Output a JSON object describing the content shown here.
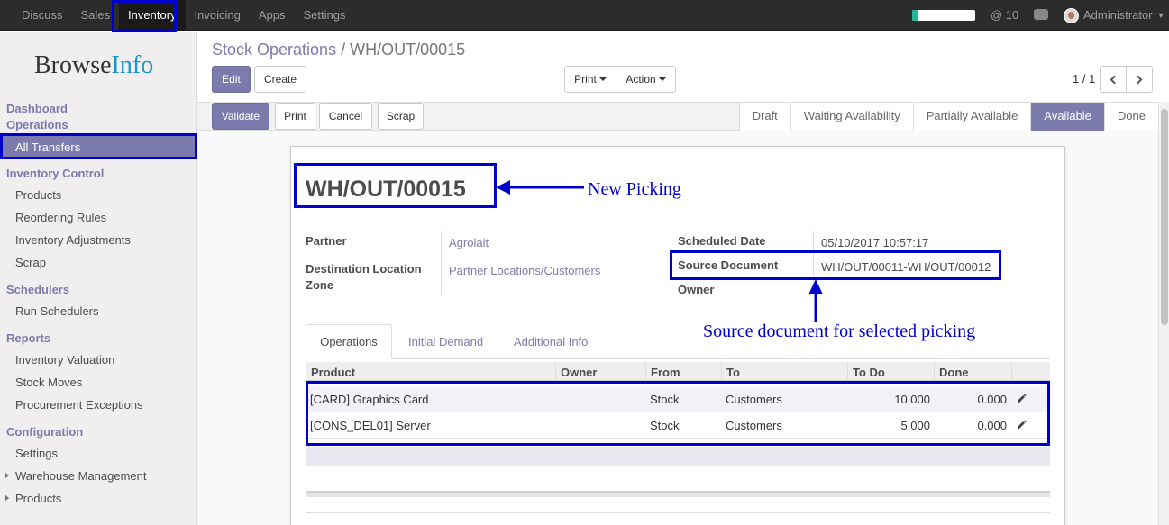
{
  "topbar": {
    "menu": [
      "Discuss",
      "Sales",
      "Inventory",
      "Invoicing",
      "Apps",
      "Settings"
    ],
    "active": "Inventory",
    "mentions": "@ 10",
    "user": "Administrator"
  },
  "sidebar": {
    "logo_main": "Browse",
    "logo_accent": "Info",
    "dashboard": "Dashboard",
    "operations": "Operations",
    "all_transfers": "All Transfers",
    "inventory_control": "Inventory Control",
    "products": "Products",
    "reordering_rules": "Reordering Rules",
    "inventory_adjustments": "Inventory Adjustments",
    "scrap": "Scrap",
    "schedulers": "Schedulers",
    "run_schedulers": "Run Schedulers",
    "reports": "Reports",
    "inventory_valuation": "Inventory Valuation",
    "stock_moves": "Stock Moves",
    "procurement_exceptions": "Procurement Exceptions",
    "configuration": "Configuration",
    "settings": "Settings",
    "warehouse_management": "Warehouse Management",
    "config_products": "Products"
  },
  "control": {
    "breadcrumb_parent": "Stock Operations",
    "breadcrumb_sep": "/",
    "breadcrumb_current": "WH/OUT/00015",
    "edit": "Edit",
    "create": "Create",
    "print": "Print",
    "action": "Action",
    "pager": "1 / 1"
  },
  "header": {
    "buttons": {
      "validate": "Validate",
      "print": "Print",
      "cancel": "Cancel",
      "scrap": "Scrap"
    },
    "states": [
      "Draft",
      "Waiting Availability",
      "Partially Available",
      "Available",
      "Done"
    ],
    "current_state": "Available"
  },
  "form": {
    "title": "WH/OUT/00015",
    "partner_label": "Partner",
    "partner": "Agrolait",
    "dest_label_1": "Destination Location",
    "dest_label_2": "Zone",
    "dest": "Partner Locations/Customers",
    "scheduled_label": "Scheduled Date",
    "scheduled": "05/10/2017 10:57:17",
    "source_label": "Source Document",
    "source": "WH/OUT/00011-WH/OUT/00012",
    "owner_label": "Owner"
  },
  "annotations": {
    "new_picking": "New Picking",
    "source_note": "Source document for selected picking"
  },
  "tabs": [
    "Operations",
    "Initial Demand",
    "Additional Info"
  ],
  "table": {
    "columns": [
      "Product",
      "Owner",
      "From",
      "To",
      "To Do",
      "Done"
    ],
    "rows": [
      {
        "product": "[CARD] Graphics Card",
        "owner": "",
        "from": "Stock",
        "to": "Customers",
        "todo": "10.000",
        "done": "0.000"
      },
      {
        "product": "[CONS_DEL01] Server",
        "owner": "",
        "from": "Stock",
        "to": "Customers",
        "todo": "5.000",
        "done": "0.000"
      }
    ]
  },
  "colors": {
    "brand": "#7c7bad",
    "annotation": "#0000cc"
  },
  "activity_progress": 0.1
}
